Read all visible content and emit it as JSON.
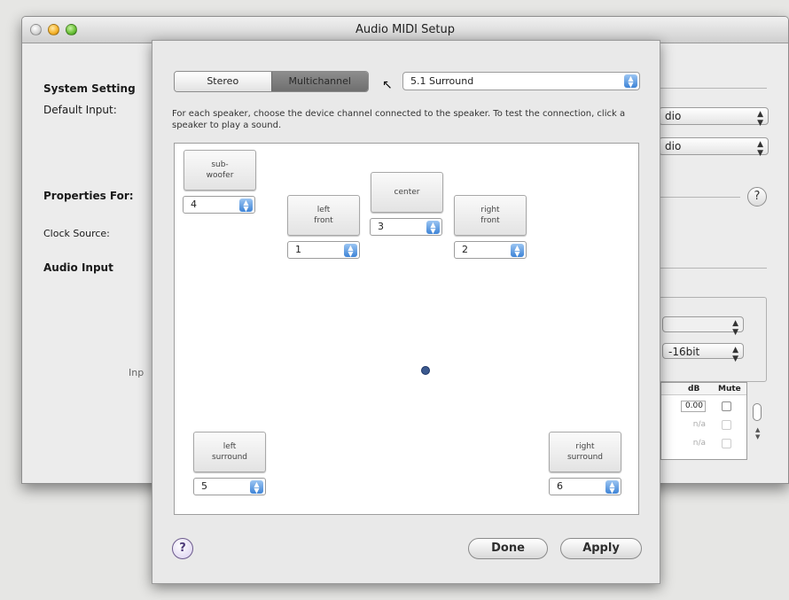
{
  "window": {
    "title": "Audio MIDI Setup"
  },
  "background": {
    "system_settings_label": "System Setting",
    "default_input_label": "Default Input:",
    "default_input_value": "dio",
    "default_output_value": "dio",
    "properties_for_label": "Properties For:",
    "clock_source_label": "Clock Source:",
    "audio_input_label": "Audio Input",
    "input_label": "Inp",
    "format_value": "-16bit",
    "help_glyph": "?",
    "table_headers": [
      "dB",
      "Mute"
    ],
    "table_rows": [
      {
        "db": "0.00"
      },
      {
        "db": "n/a"
      },
      {
        "db": "n/a"
      }
    ]
  },
  "sheet": {
    "segments": [
      {
        "label": "Stereo",
        "selected": false
      },
      {
        "label": "Multichannel",
        "selected": true
      }
    ],
    "layout_popup": "5.1 Surround",
    "instructions": "For each speaker, choose the device channel connected to the speaker.  To test the connection, click a speaker to play a sound.",
    "speakers": {
      "subwoofer": {
        "label": "sub-\nwoofer",
        "channel": "4"
      },
      "left_front": {
        "label": "left\nfront",
        "channel": "1"
      },
      "center": {
        "label": "center",
        "channel": "3"
      },
      "right_front": {
        "label": "right\nfront",
        "channel": "2"
      },
      "left_surround": {
        "label": "left\nsurround",
        "channel": "5"
      },
      "right_surround": {
        "label": "right\nsurround",
        "channel": "6"
      }
    },
    "help_glyph": "?",
    "done_label": "Done",
    "apply_label": "Apply"
  },
  "colors": {
    "accent_blue": "#3e84d6",
    "selected_segment": "#7c7c7c"
  },
  "icons": [
    "close-icon",
    "minimize-icon",
    "zoom-icon",
    "help-icon",
    "popup-arrows-icon",
    "arrow-cursor-icon"
  ]
}
